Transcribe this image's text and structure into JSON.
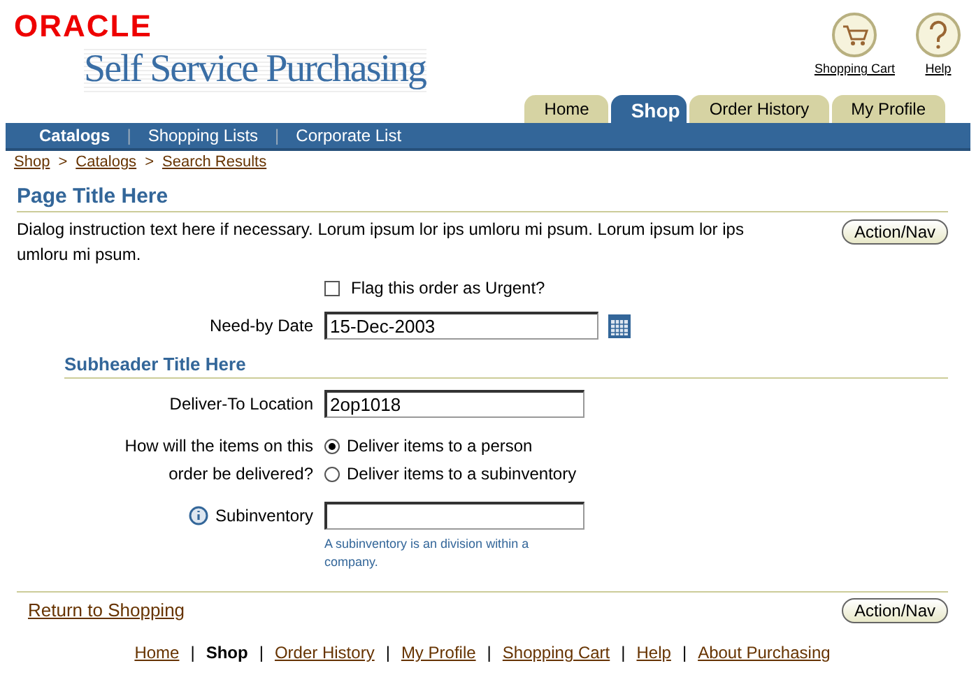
{
  "brand": {
    "logo": "ORACLE",
    "product": "Self Service Purchasing"
  },
  "global_links": [
    {
      "label": "Shopping Cart",
      "kind": "cart"
    },
    {
      "label": "Help",
      "kind": "help"
    }
  ],
  "tabs": [
    {
      "label": "Home",
      "selected": false
    },
    {
      "label": "Shop",
      "selected": true
    },
    {
      "label": "Order History",
      "selected": false
    },
    {
      "label": "My Profile",
      "selected": false
    }
  ],
  "subtabs": [
    {
      "label": "Catalogs",
      "selected": true
    },
    {
      "label": "Shopping Lists",
      "selected": false
    },
    {
      "label": "Corporate List",
      "selected": false
    }
  ],
  "subtab_separator": "|",
  "breadcrumbs": [
    "Shop",
    "Catalogs",
    "Search Results"
  ],
  "breadcrumb_separator": ">",
  "page_title": "Page Title Here",
  "instruction": "Dialog instruction text here if necessary. Lorum ipsum lor ips umloru mi psum. Lorum ipsum lor ips umloru mi psum.",
  "action_button": "Action/Nav",
  "urgent": {
    "label": "Flag this order as Urgent?",
    "checked": false
  },
  "need_by": {
    "label": "Need-by Date",
    "value": "15-Dec-2003"
  },
  "subheader": "Subheader Title Here",
  "deliver_to": {
    "label": "Deliver-To Location",
    "value": "2op1018"
  },
  "delivery": {
    "label": "How will the items on this order be delivered?",
    "options": [
      {
        "label": "Deliver items to a person",
        "selected": true
      },
      {
        "label": "Deliver items to a subinventory",
        "selected": false
      }
    ]
  },
  "subinventory": {
    "label": "Subinventory",
    "hint": "A subinventory is an division within a company."
  },
  "return_link": "Return to Shopping",
  "bottom_button": "Action/Nav",
  "footer": [
    {
      "label": "Home",
      "selected": false
    },
    {
      "label": "Shop",
      "selected": true
    },
    {
      "label": "Order History",
      "selected": false
    },
    {
      "label": "My Profile",
      "selected": false
    },
    {
      "label": "Shopping Cart",
      "selected": false
    },
    {
      "label": "Help",
      "selected": false
    },
    {
      "label": "About Purchasing",
      "selected": false
    }
  ],
  "footer_separator": "|"
}
